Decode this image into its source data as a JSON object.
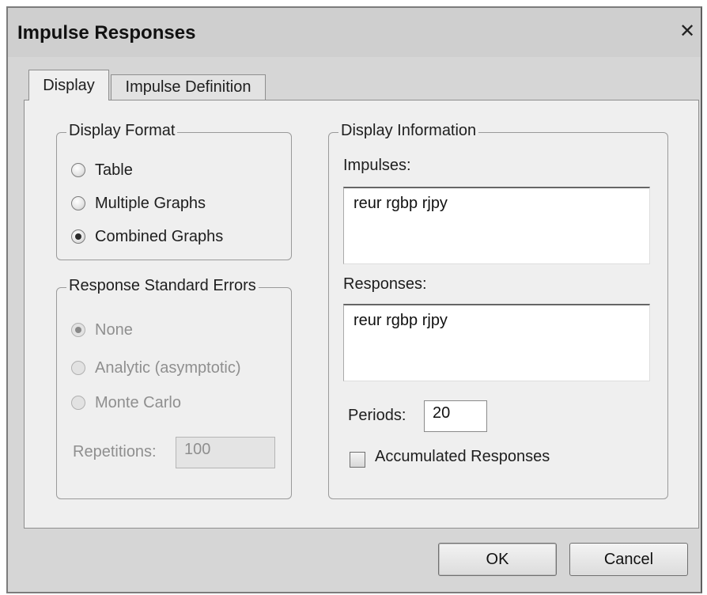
{
  "window": {
    "title": "Impulse Responses",
    "close_glyph": "✕"
  },
  "tabs": [
    {
      "label": "Display",
      "active": true
    },
    {
      "label": "Impulse Definition",
      "active": false
    }
  ],
  "display_format": {
    "legend": "Display Format",
    "options": [
      {
        "label": "Table",
        "checked": false
      },
      {
        "label": "Multiple Graphs",
        "checked": false
      },
      {
        "label": "Combined Graphs",
        "checked": true
      }
    ]
  },
  "standard_errors": {
    "legend": "Response Standard Errors",
    "enabled": false,
    "options": [
      {
        "label": "None",
        "checked": true
      },
      {
        "label": "Analytic (asymptotic)",
        "checked": false
      },
      {
        "label": "Monte Carlo",
        "checked": false
      }
    ],
    "repetitions_label": "Repetitions:",
    "repetitions_value": "100"
  },
  "display_information": {
    "legend": "Display Information",
    "impulses_label": "Impulses:",
    "impulses_value": "reur rgbp rjpy",
    "responses_label": "Responses:",
    "responses_value": "reur rgbp rjpy",
    "periods_label": "Periods:",
    "periods_value": "20",
    "accumulated_label": "Accumulated Responses",
    "accumulated_checked": false
  },
  "buttons": {
    "ok": "OK",
    "cancel": "Cancel"
  }
}
